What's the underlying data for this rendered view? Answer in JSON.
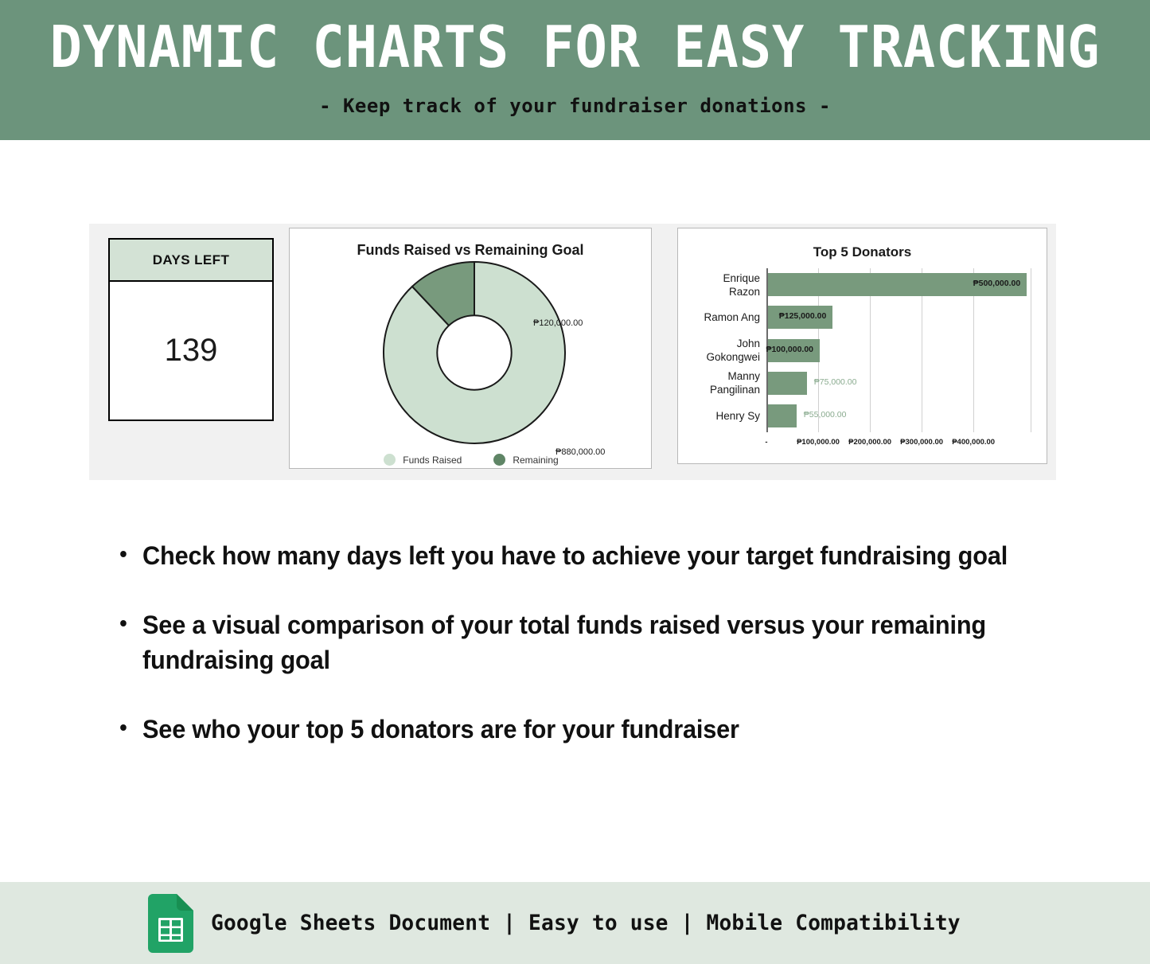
{
  "header": {
    "title": "DYNAMIC CHARTS FOR EASY TRACKING",
    "subtitle": "- Keep track of your fundraiser donations -"
  },
  "colors": {
    "header_green": "#6c947c",
    "footer_green": "#dfe8e0",
    "light_green": "#cde0d0",
    "dark_green": "#789a7d",
    "card_header_green": "#d3e2d5",
    "strip_gray": "#f1f1f1"
  },
  "dashboard": {
    "days_left_card": {
      "header_label": "DAYS LEFT",
      "value": "139"
    },
    "chart_data": [
      {
        "type": "pie",
        "variant": "donut",
        "title": "Funds Raised vs Remaining Goal",
        "labels": [
          "Funds Raised",
          "Remaining"
        ],
        "values": [
          880000,
          120000
        ],
        "data_labels": [
          "₱880,000.00",
          "₱120,000.00"
        ],
        "colors": [
          "#cde0d0",
          "#789a7d"
        ],
        "legend": [
          "Funds Raised",
          "Remaining"
        ],
        "legend_position": "bottom",
        "total": 1000000,
        "start_angle_deg": 0,
        "direction": "counterclockwise",
        "inner_radius_ratio": 0.41
      },
      {
        "type": "bar",
        "orientation": "horizontal",
        "title": "Top 5 Donators",
        "categories": [
          "Enrique Razon",
          "Ramon Ang",
          "John Gokongwei",
          "Manny Pangilinan",
          "Henry Sy"
        ],
        "values": [
          500000,
          125000,
          100000,
          75000,
          55000
        ],
        "data_labels": [
          "₱500,000.00",
          "₱125,000.00",
          "₱100,000.00",
          "₱75,000.00",
          "₱55,000.00"
        ],
        "label_placement": [
          "inside",
          "inside",
          "inside",
          "outside",
          "outside"
        ],
        "xlabel": "",
        "ylabel": "",
        "xlim": [
          0,
          512000
        ],
        "xticks": [
          0,
          100000,
          200000,
          300000,
          400000
        ],
        "xtick_labels": [
          "-",
          "₱100,000.00",
          "₱200,000.00",
          "₱300,000.00",
          "₱400,000.00"
        ],
        "grid": true,
        "legend_position": "none",
        "bar_color": "#789a7d"
      }
    ]
  },
  "bullets": [
    "Check how many days left you have to achieve your target fundraising goal",
    "See a visual comparison of your total funds raised versus your remaining fundraising goal",
    "See who your top 5 donators are for your fundraiser"
  ],
  "footer": {
    "icon": "google-sheets-icon",
    "text": "Google Sheets Document  | Easy to use | Mobile Compatibility"
  }
}
